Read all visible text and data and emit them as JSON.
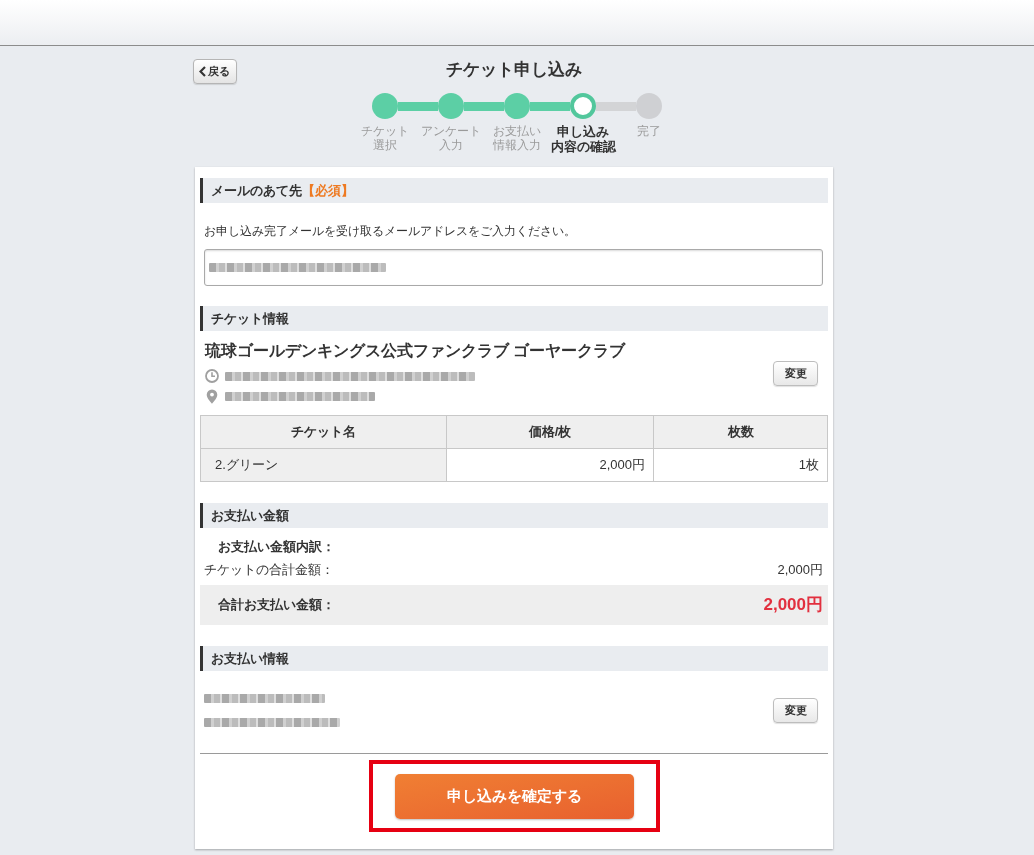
{
  "header": {
    "back_button": "戻る",
    "title": "チケット申し込み"
  },
  "steps": [
    {
      "lines": [
        "チケット",
        "選択"
      ],
      "completed": true,
      "current": false
    },
    {
      "lines": [
        "アンケート",
        "入力"
      ],
      "completed": true,
      "current": false
    },
    {
      "lines": [
        "お支払い",
        "情報入力"
      ],
      "completed": true,
      "current": false
    },
    {
      "lines": [
        "申し込み",
        "内容の確認"
      ],
      "completed": false,
      "current": true
    },
    {
      "lines": [
        "完了"
      ],
      "completed": false,
      "current": false
    }
  ],
  "email_section": {
    "heading": "メールのあて先",
    "required_mark": "【必須】",
    "instruction": "お申し込み完了メールを受け取るメールアドレスをご入力ください。",
    "email_field": {
      "value_redacted": true
    }
  },
  "ticket_section": {
    "heading": "チケット情報",
    "event_title": "琉球ゴールデンキングス公式ファンクラブ ゴーヤークラブ",
    "details": [
      {
        "kind": "time",
        "redacted": true
      },
      {
        "kind": "place",
        "redacted": true
      }
    ],
    "change_button": "変更",
    "table": {
      "columns": [
        "チケット名",
        "価格/枚",
        "枚数"
      ],
      "rows": [
        [
          "2.グリーン",
          "2,000円",
          "1枚"
        ]
      ]
    }
  },
  "payment_amount_section": {
    "heading": "お支払い金額",
    "breakdown_label": "お支払い金額内訳：",
    "lines": [
      {
        "label": "チケットの合計金額：",
        "value": "2,000円"
      }
    ],
    "total": {
      "label": "合計お支払い金額：",
      "value": "2,000円"
    }
  },
  "payment_info_section": {
    "heading": "お支払い情報",
    "lines": [
      {
        "redacted": true
      },
      {
        "redacted": true
      }
    ],
    "change_button": "変更"
  },
  "confirm_button": {
    "label": "申し込みを確定する",
    "highlighted": true
  }
}
